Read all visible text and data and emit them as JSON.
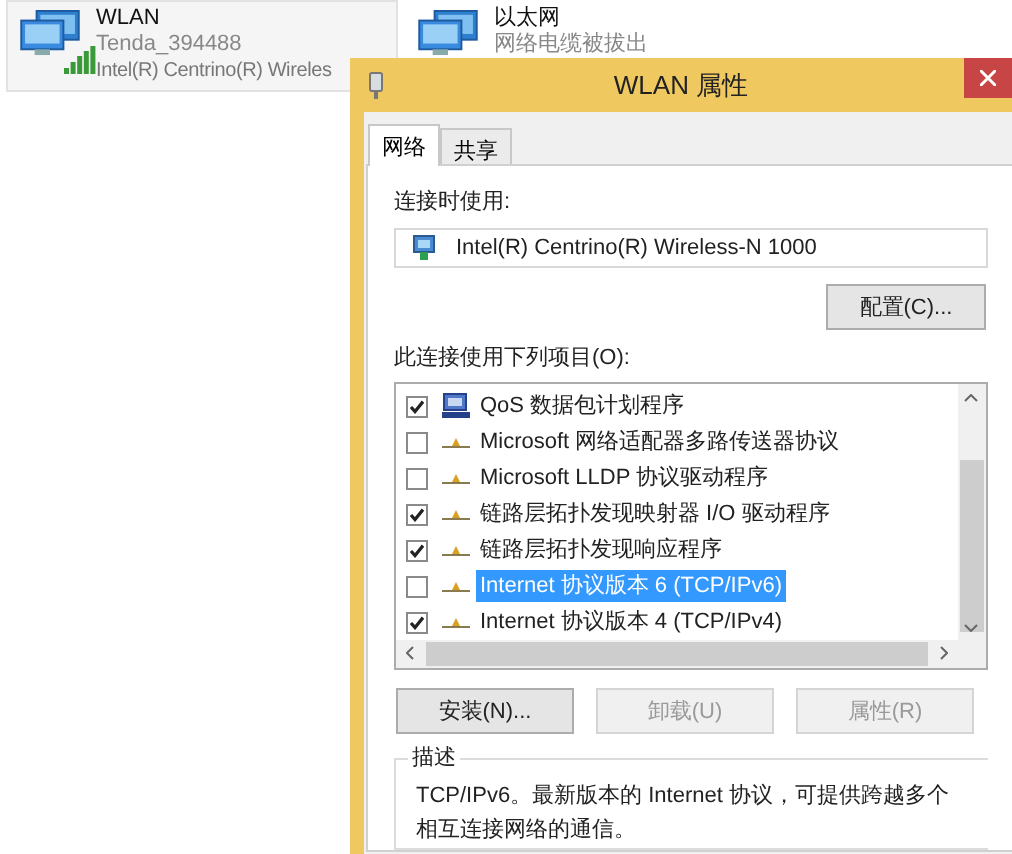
{
  "adapters": [
    {
      "kind": "wifi",
      "name": "WLAN",
      "status": "Tenda_394488",
      "device": "Intel(R) Centrino(R) Wireles",
      "selected": true
    },
    {
      "kind": "ethernet",
      "name": "以太网",
      "status": "网络电缆被拔出",
      "selected": false
    }
  ],
  "dialog": {
    "title": "WLAN 属性",
    "tabs": [
      {
        "label": "网络",
        "selected": true
      },
      {
        "label": "共享",
        "selected": false
      }
    ],
    "connect_using_label": "连接时使用:",
    "adapter": "Intel(R) Centrino(R) Wireless-N 1000",
    "configure_button": "配置(C)...",
    "items_label": "此连接使用下列项目(O):",
    "items": [
      {
        "kind": "scheduler",
        "label": "QoS 数据包计划程序",
        "checked": true,
        "selected": false
      },
      {
        "kind": "protocol",
        "label": "Microsoft 网络适配器多路传送器协议",
        "checked": false,
        "selected": false
      },
      {
        "kind": "protocol",
        "label": "Microsoft LLDP 协议驱动程序",
        "checked": false,
        "selected": false
      },
      {
        "kind": "protocol",
        "label": "链路层拓扑发现映射器 I/O 驱动程序",
        "checked": true,
        "selected": false
      },
      {
        "kind": "protocol",
        "label": "链路层拓扑发现响应程序",
        "checked": true,
        "selected": false
      },
      {
        "kind": "protocol",
        "label": "Internet 协议版本 6 (TCP/IPv6)",
        "checked": false,
        "selected": true
      },
      {
        "kind": "protocol",
        "label": "Internet 协议版本 4 (TCP/IPv4)",
        "checked": true,
        "selected": false
      }
    ],
    "buttons": [
      {
        "label": "安装(N)...",
        "disabled": false
      },
      {
        "label": "卸载(U)",
        "disabled": true
      },
      {
        "label": "属性(R)",
        "disabled": true
      }
    ],
    "description": {
      "title": "描述",
      "text": "TCP/IPv6。最新版本的 Internet 协议，可提供跨越多个相互连接网络的通信。"
    }
  }
}
